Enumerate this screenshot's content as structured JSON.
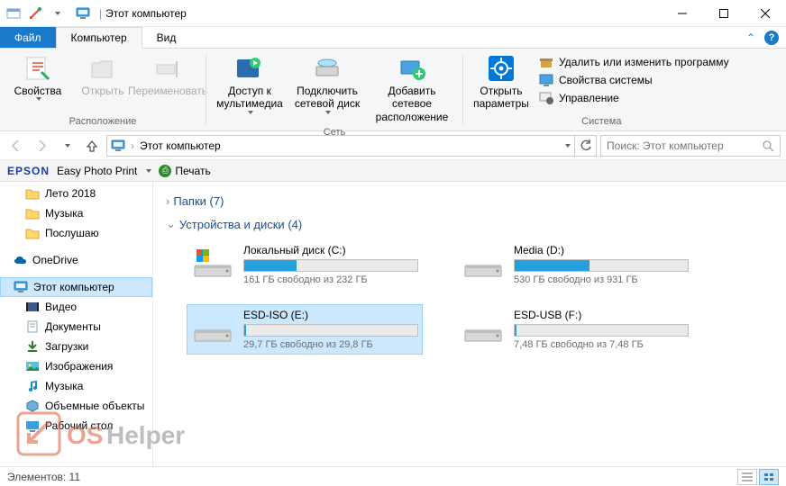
{
  "window": {
    "title": "Этот компьютер"
  },
  "tabs": {
    "file": "Файл",
    "computer": "Компьютер",
    "view": "Вид"
  },
  "ribbon": {
    "location": {
      "label": "Расположение",
      "properties": "Свойства",
      "open": "Открыть",
      "rename": "Переименовать"
    },
    "network": {
      "label": "Сеть",
      "media": "Доступ к мультимедиа",
      "mapdrive": "Подключить сетевой диск",
      "addloc": "Добавить сетевое расположение"
    },
    "system": {
      "label": "Система",
      "settings": "Открыть параметры",
      "uninstall": "Удалить или изменить программу",
      "sysprops": "Свойства системы",
      "manage": "Управление"
    }
  },
  "address": {
    "crumb": "Этот компьютер"
  },
  "search": {
    "placeholder": "Поиск: Этот компьютер"
  },
  "epson": {
    "logo": "EPSON",
    "app": "Easy Photo Print",
    "print": "Печать"
  },
  "tree": {
    "items": [
      {
        "label": "Лето 2018",
        "icon": "folder"
      },
      {
        "label": "Музыка",
        "icon": "folder"
      },
      {
        "label": "Послушаю",
        "icon": "folder"
      },
      {
        "label": "OneDrive",
        "icon": "onedrive",
        "level0": true,
        "spaceBefore": true
      },
      {
        "label": "Этот компьютер",
        "icon": "pc",
        "level0": true,
        "selected": true,
        "spaceBefore": true
      },
      {
        "label": "Видео",
        "icon": "video"
      },
      {
        "label": "Документы",
        "icon": "docs"
      },
      {
        "label": "Загрузки",
        "icon": "downloads"
      },
      {
        "label": "Изображения",
        "icon": "pictures"
      },
      {
        "label": "Музыка",
        "icon": "music"
      },
      {
        "label": "Объемные объекты",
        "icon": "3d"
      },
      {
        "label": "Рабочий стол",
        "icon": "desktop"
      }
    ]
  },
  "sections": {
    "folders": {
      "label": "Папки",
      "count": 7
    },
    "drives": {
      "label": "Устройства и диски",
      "count": 4
    }
  },
  "drives": [
    {
      "name": "Локальный диск (C:)",
      "free": "161 ГБ свободно из 232 ГБ",
      "fill": 30,
      "os": true
    },
    {
      "name": "Media (D:)",
      "free": "530 ГБ свободно из 931 ГБ",
      "fill": 43
    },
    {
      "name": "ESD-ISO (E:)",
      "free": "29,7 ГБ свободно из 29,8 ГБ",
      "fill": 1,
      "selected": true
    },
    {
      "name": "ESD-USB (F:)",
      "free": "7,48 ГБ свободно из 7,48 ГБ",
      "fill": 1
    }
  ],
  "status": {
    "label": "Элементов:",
    "count": 11
  }
}
